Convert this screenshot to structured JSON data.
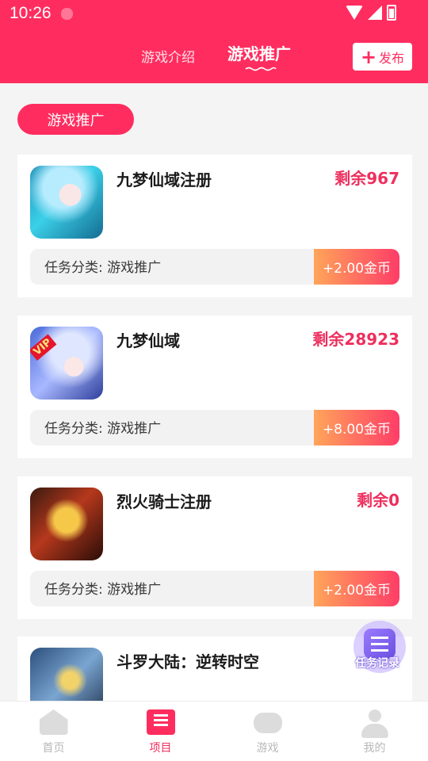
{
  "status_bar": {
    "time": "10:26"
  },
  "top_nav": {
    "tabs": [
      {
        "label": "游戏介绍",
        "active": false
      },
      {
        "label": "游戏推广",
        "active": true
      }
    ],
    "publish_label": "发布"
  },
  "section_title": "游戏推广",
  "tasks": [
    {
      "title": "九梦仙域注册",
      "remaining": "剩余967",
      "category": "任务分类: 游戏推广",
      "reward": "+2.00金币"
    },
    {
      "title": "九梦仙域",
      "remaining": "剩余28923",
      "category": "任务分类: 游戏推广",
      "reward": "+8.00金币",
      "badge": "VIP"
    },
    {
      "title": "烈火骑士注册",
      "remaining": "剩余0",
      "category": "任务分类: 游戏推广",
      "reward": "+2.00金币"
    },
    {
      "title": "斗罗大陆：逆转时空"
    }
  ],
  "floating_button": {
    "label": "任务记录"
  },
  "bottom_nav": [
    {
      "label": "首页",
      "icon": "home-icon",
      "active": false
    },
    {
      "label": "项目",
      "icon": "project-icon",
      "active": true
    },
    {
      "label": "游戏",
      "icon": "gamepad-icon",
      "active": false
    },
    {
      "label": "我的",
      "icon": "user-icon",
      "active": false
    }
  ],
  "colors": {
    "brand": "#ff2d5f",
    "remaining": "#ee2f5e",
    "reward_gradient_start": "#ffa55a",
    "reward_gradient_end": "#ff3d67"
  }
}
